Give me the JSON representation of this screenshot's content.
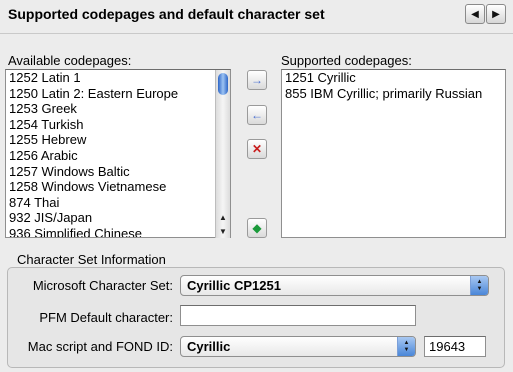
{
  "header": {
    "title": "Supported codepages and  default character set",
    "prev_icon": "◀",
    "next_icon": "▶"
  },
  "available": {
    "label": "Available codepages:",
    "items": [
      "1252  Latin 1",
      "1250  Latin 2: Eastern Europe",
      "1253  Greek",
      "1254  Turkish",
      "1255  Hebrew",
      "1256  Arabic",
      "1257  Windows Baltic",
      "1258  Windows Vietnamese",
      "874  Thai",
      "932  JIS/Japan",
      "936  Simplified Chinese"
    ]
  },
  "supported": {
    "label": "Supported codepages:",
    "items": [
      "1251  Cyrillic",
      "855  IBM Cyrillic; primarily Russian"
    ]
  },
  "tools": {
    "add_icon": "→",
    "remove_icon": "←",
    "delete_icon": "✕",
    "default_icon": "◆"
  },
  "charset": {
    "section_title": "Character Set Information",
    "ms_label": "Microsoft Character Set:",
    "ms_value": "Cyrillic CP1251",
    "pfm_label": "PFM Default character:",
    "pfm_value": "",
    "mac_label": "Mac script and FOND ID:",
    "mac_value": "Cyrillic",
    "fond_id": "19643"
  }
}
